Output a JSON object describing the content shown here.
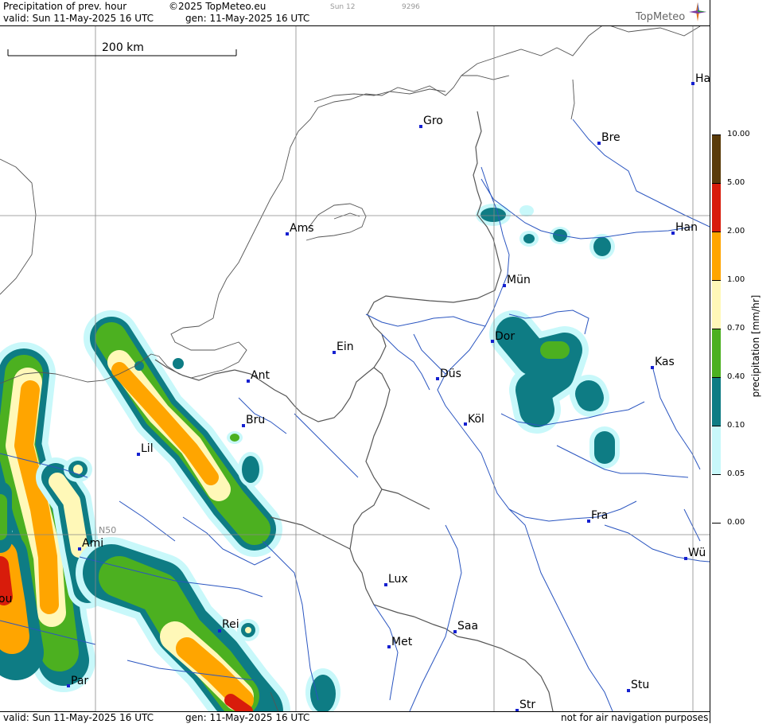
{
  "header": {
    "product": "Precipitation of prev. hour",
    "copyright": "©2025 TopMeteo.eu",
    "small_day": "Sun 12",
    "small_code": "9296",
    "valid": "valid:  Sun  11-May-2025  16 UTC",
    "gen": "gen: 11-May-2025 16 UTC",
    "brand": "TopMeteo"
  },
  "footer": {
    "valid": "valid:  Sun  11-May-2025  16 UTC",
    "gen": "gen: 11-May-2025 16 UTC",
    "note": "not for air navigation purposes"
  },
  "map": {
    "scale_label": "200 km",
    "lat_label": "N50",
    "cities": [
      "Ha",
      "Gro",
      "Bre",
      "Ams",
      "Han",
      "Mün",
      "Ein",
      "Dor",
      "Ant",
      "Düs",
      "Kas",
      "Bru",
      "Köl",
      "Lil",
      "Fra",
      "Ami",
      "Wü",
      "ou",
      "Lux",
      "Rei",
      "Saa",
      "Met",
      "Par",
      "Stu",
      "Str"
    ]
  },
  "legend": {
    "unit": "precipitation [mm/hr]",
    "levels": [
      "10.00",
      "5.00",
      "2.00",
      "1.00",
      "0.70",
      "0.40",
      "0.10",
      "0.05",
      "0.00"
    ],
    "colors": [
      "#5a3b0a",
      "#d81c0b",
      "#ffa500",
      "#fff8b8",
      "#4cb020",
      "#0e7c84",
      "#c8f8fa",
      "#ffffff"
    ]
  }
}
